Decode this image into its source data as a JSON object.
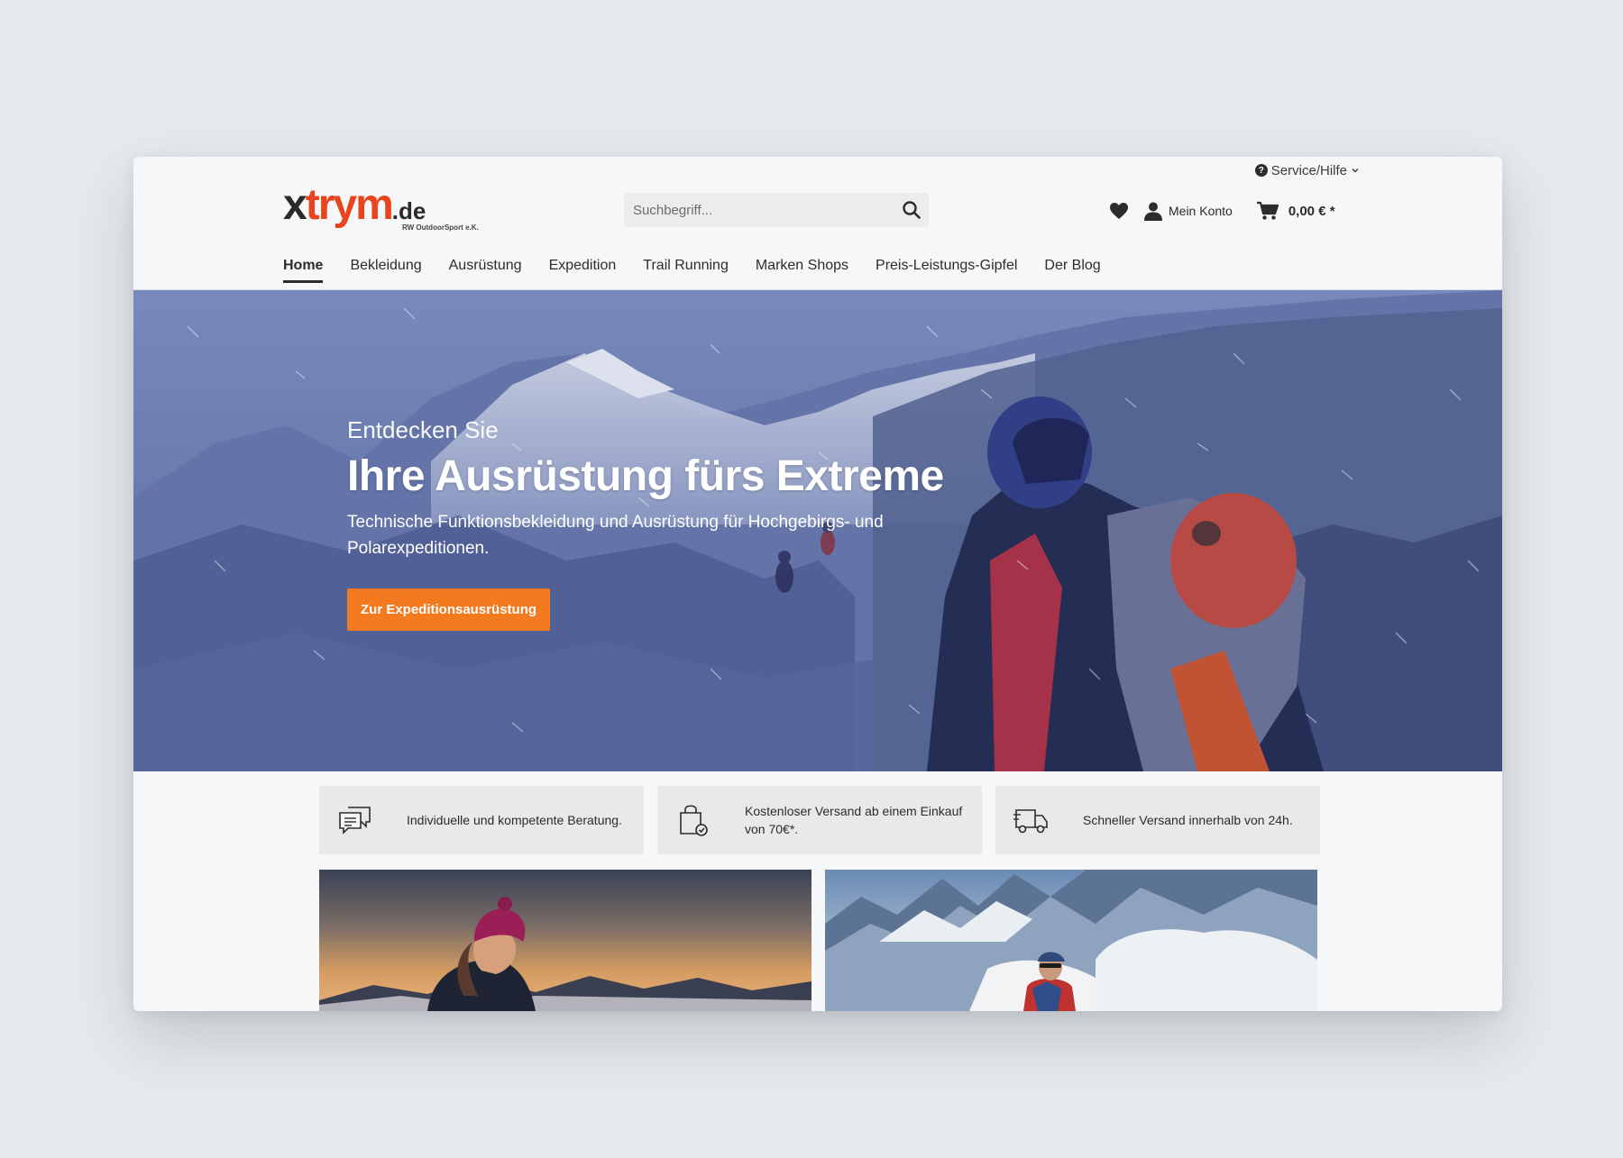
{
  "header": {
    "service_label": "Service/Hilfe",
    "logo": {
      "part1": "x",
      "part2": "trym",
      "part3": ".de",
      "tagline": "RW OutdoorSport e.K."
    },
    "search": {
      "placeholder": "Suchbegriff..."
    },
    "account_label": "Mein Konto",
    "cart_total": "0,00 € *"
  },
  "nav": {
    "items": [
      {
        "label": "Home",
        "active": true
      },
      {
        "label": "Bekleidung"
      },
      {
        "label": "Ausrüstung"
      },
      {
        "label": "Expedition"
      },
      {
        "label": "Trail Running"
      },
      {
        "label": "Marken Shops"
      },
      {
        "label": "Preis-Leistungs-Gipfel"
      },
      {
        "label": "Der Blog"
      }
    ]
  },
  "hero": {
    "kicker": "Entdecken Sie",
    "title": "Ihre Ausrüstung fürs Extreme",
    "description": "Technische Funktionsbekleidung und Ausrüstung für Hochgebirgs- und Polarexpeditionen.",
    "button_label": "Zur Expeditionsausrüstung"
  },
  "usps": [
    {
      "icon": "chat-bubbles-icon",
      "text": "Individuelle und kompetente Beratung."
    },
    {
      "icon": "shopping-bag-check-icon",
      "text": "Kostenloser Versand ab einem Einkauf von 70€*."
    },
    {
      "icon": "delivery-truck-icon",
      "text": "Schneller Versand innerhalb von 24h."
    }
  ],
  "colors": {
    "accent": "#f47a1f",
    "brand_red": "#e8451e",
    "text": "#2c2c2c"
  }
}
